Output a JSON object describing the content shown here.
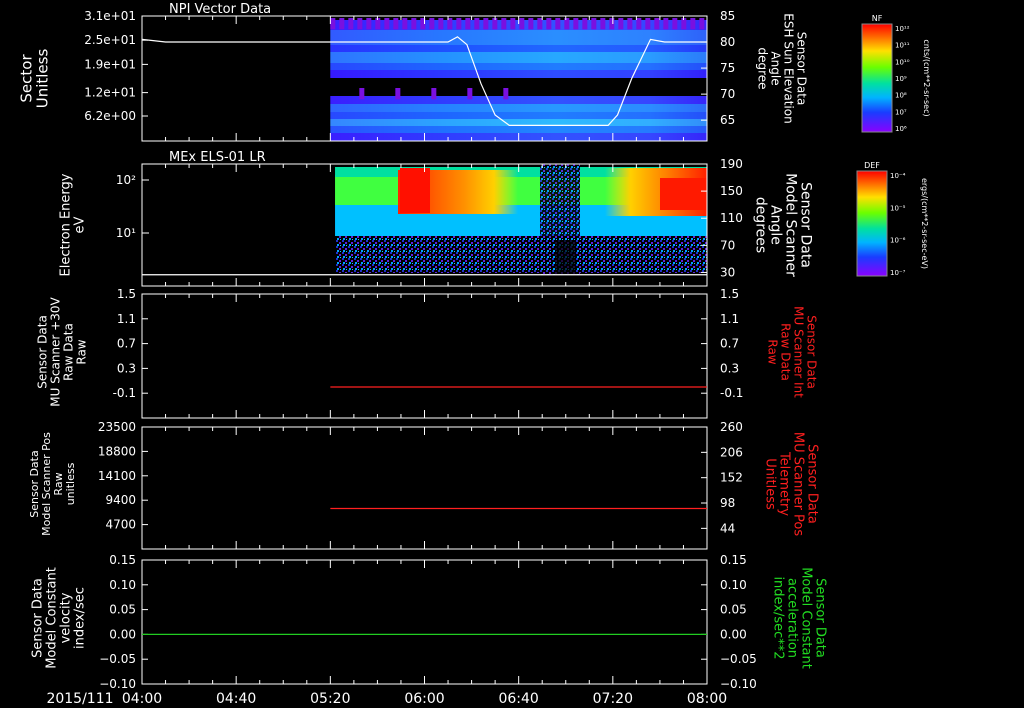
{
  "time_axis": {
    "date_label": "2015/111",
    "tick_labels": [
      "04:00",
      "04:40",
      "05:20",
      "06:00",
      "06:40",
      "07:20",
      "08:00"
    ],
    "range": [
      "04:00",
      "08:00"
    ]
  },
  "colors": {
    "trace_white": "#ffffff",
    "trace_red": "#ff2020",
    "trace_green": "#22cc22",
    "label_red": "#ff1f1f",
    "label_green": "#22dd22"
  },
  "colorbars": [
    {
      "name": "NPI",
      "title": "NF",
      "unit": "cnts/(cm**2-sr-sec)",
      "scale": "log",
      "tick_labels": [
        "10¹²",
        "10¹¹",
        "10¹⁰",
        "10⁹",
        "10⁸",
        "10⁷",
        "10⁶"
      ]
    },
    {
      "name": "ELS",
      "title": "DEF",
      "unit": "ergs/(cm**2-sr-sec-eV)",
      "scale": "log",
      "tick_labels": [
        "10⁻⁴",
        "10⁻⁵",
        "10⁻⁶",
        "10⁻⁷"
      ]
    }
  ],
  "chart_data": [
    {
      "type": "heatmap",
      "title": "NPI Vector Data",
      "ylabel": [
        "Sector",
        "Unitless"
      ],
      "y_tick_labels": [
        "3.1e+01",
        "2.5e+01",
        "1.9e+01",
        "1.2e+01",
        "6.2e+00"
      ],
      "ylim": [
        0,
        31
      ],
      "y2label": [
        "Sensor Data",
        "ESH Sun Elevation",
        "Angle",
        "degree"
      ],
      "y2_ticks": [
        85,
        80,
        75,
        70,
        65
      ],
      "y2lim": [
        61,
        85
      ],
      "data_start": "05:20",
      "line_series": {
        "name": "ESH Sun Elevation Angle",
        "x": [
          "04:00",
          "04:10",
          "05:20",
          "06:10",
          "06:14",
          "06:18",
          "06:24",
          "06:30",
          "06:36",
          "07:18",
          "07:22",
          "07:28",
          "07:36",
          "07:42",
          "08:00"
        ],
        "y": [
          80.5,
          80,
          80,
          80,
          81,
          79.5,
          72,
          66,
          64,
          64,
          66,
          73,
          80.5,
          80,
          80
        ]
      }
    },
    {
      "type": "heatmap",
      "title": "MEx ELS-01 LR",
      "ylabel": [
        "Electron Energy",
        "eV"
      ],
      "y_tick_labels": [
        "10²",
        "10¹"
      ],
      "yscale": "log",
      "y2label": [
        "Sensor Data",
        "Model Scanner",
        "Angle",
        "degrees"
      ],
      "y2_ticks": [
        190,
        150,
        110,
        70,
        30
      ],
      "y2lim": [
        0,
        190
      ],
      "data_start": "05:22",
      "line_series": {
        "name": "Model Scanner Angle",
        "x": [
          "04:00",
          "08:00"
        ],
        "y": [
          2,
          2
        ]
      }
    },
    {
      "type": "line",
      "ylabel": [
        "Sensor Data",
        "MU Scanner +30V",
        "Raw Data",
        "Raw"
      ],
      "y_ticks": [
        1.5,
        1.1,
        0.7,
        0.3,
        -0.1
      ],
      "ylim": [
        -0.5,
        1.5
      ],
      "y2label": [
        "Sensor Data",
        "MU Scanner Int",
        "Raw Data",
        "Raw"
      ],
      "y2_ticks": [
        1.5,
        1.1,
        0.7,
        0.3,
        -0.1
      ],
      "series": [
        {
          "x": [
            "05:20",
            "08:00"
          ],
          "y": [
            0.0,
            0.0
          ]
        }
      ]
    },
    {
      "type": "line",
      "ylabel": [
        "Sensor Data",
        "Model Scanner Pos",
        "Raw",
        "unitless"
      ],
      "y_ticks": [
        23500,
        18800,
        14100,
        9400,
        4700
      ],
      "ylim": [
        0,
        23500
      ],
      "y2label": [
        "Sensor Data",
        "MU Scanner Pos",
        "Telemetry",
        "Unitless"
      ],
      "y2_ticks": [
        260,
        206,
        152,
        98,
        44
      ],
      "y2lim": [
        0,
        260
      ],
      "series": [
        {
          "x": [
            "05:20",
            "08:00"
          ],
          "y": [
            7800,
            7800
          ]
        }
      ]
    },
    {
      "type": "line",
      "ylabel": [
        "Sensor Data",
        "Model Constant",
        "velocity",
        "index/sec"
      ],
      "y_ticks": [
        0.15,
        0.1,
        0.05,
        0.0,
        -0.05,
        -0.1
      ],
      "y_tick_labels": [
        "0.15",
        "0.10",
        "0.05",
        "0.00",
        "−0.05",
        "−0.10"
      ],
      "ylim": [
        -0.1,
        0.15
      ],
      "y2label": [
        "Sensor Data",
        "Model Constant",
        "acceleration",
        "index/sec**2"
      ],
      "y2_ticks": [
        0.15,
        0.1,
        0.05,
        0.0,
        -0.05,
        -0.1
      ],
      "y2_tick_labels": [
        "0.15",
        "0.10",
        "0.05",
        "0.00",
        "−0.05",
        "−0.10"
      ],
      "series": [
        {
          "x": [
            "04:00",
            "08:00"
          ],
          "y": [
            0.0,
            0.0
          ]
        }
      ]
    }
  ]
}
